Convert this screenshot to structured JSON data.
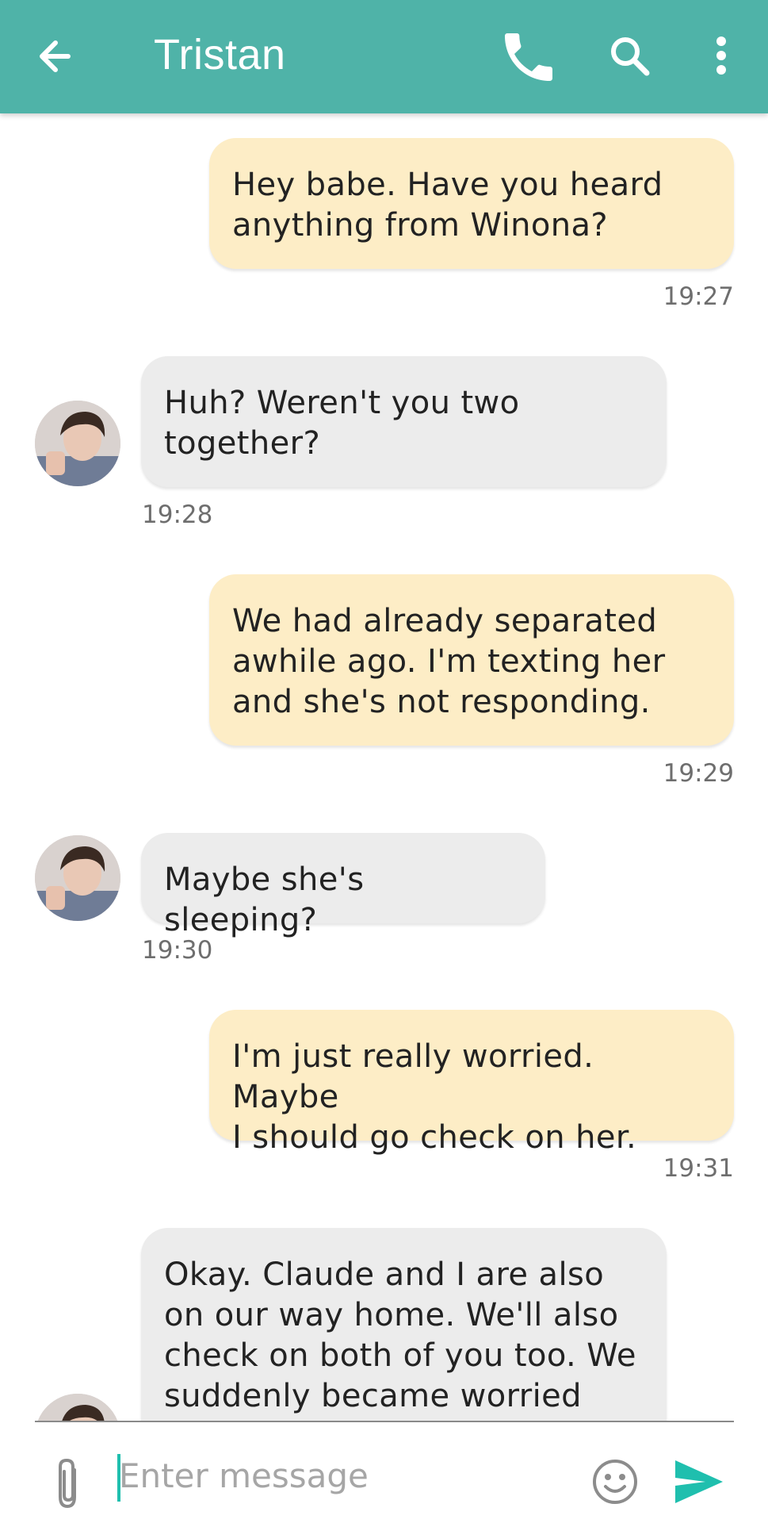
{
  "header": {
    "title": "Tristan",
    "background_color": "#4fb3a8",
    "icons": [
      "back-arrow-icon",
      "phone-icon",
      "search-icon",
      "more-vert-icon"
    ]
  },
  "messages": [
    {
      "direction": "outgoing",
      "text": "Hey babe. Have you heard\nanything from Winona?",
      "time": "19:27"
    },
    {
      "direction": "incoming",
      "text": "Huh? Weren't you two\ntogether?",
      "time": "19:28"
    },
    {
      "direction": "outgoing",
      "text": "We had already separated\nawhile ago. I'm texting her\nand she's not responding.",
      "time": "19:29"
    },
    {
      "direction": "incoming",
      "text": "Maybe she's sleeping?",
      "time": "19:30"
    },
    {
      "direction": "outgoing",
      "text": "I'm just really worried. Maybe\nI should go check on her.",
      "time": "19:31"
    },
    {
      "direction": "incoming",
      "text": "Okay. Claude and I are also\non our way home. We'll also\ncheck on both of you too. We\nsuddenly became worried",
      "time": ""
    }
  ],
  "composer": {
    "placeholder": "Enter message",
    "icons": [
      "paperclip-icon",
      "emoji-icon",
      "send-icon"
    ],
    "accent_color": "#1fbfae"
  },
  "colors": {
    "outgoing_bubble": "#fdedc6",
    "incoming_bubble": "#ececec"
  }
}
